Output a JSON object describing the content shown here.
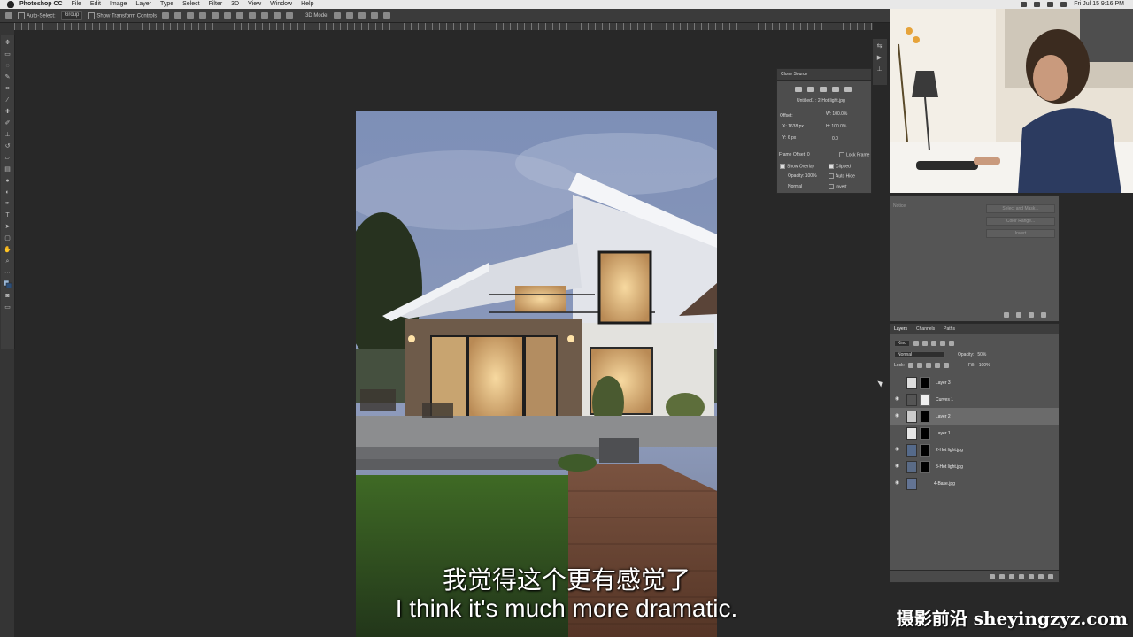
{
  "menubar": {
    "app_name": "Photoshop CC",
    "items": [
      "File",
      "Edit",
      "Image",
      "Layer",
      "Type",
      "Select",
      "Filter",
      "3D",
      "View",
      "Window",
      "Help"
    ],
    "clock": "Fri Jul 15  9:16 PM"
  },
  "optionsbar": {
    "auto_select_label": "Auto-Select:",
    "auto_select_value": "Group",
    "show_transform_label": "Show Transform Controls",
    "mode_3d_label": "3D Mode:"
  },
  "clone_source": {
    "title": "Clone Source",
    "source_name": "Untitled1 : 2-Hot light.jpg",
    "offset_label": "Offset:",
    "w_value": "W: 100.0%",
    "h_value": "H: 100.0%",
    "x_value": "X: 1638 px",
    "y_value": "Y: 6 px",
    "angle_value": "0.0",
    "frame_offset_label": "Frame Offset: 0",
    "lock_frame_label": "Lock Frame",
    "show_overlay_label": "Show Overlay",
    "clipped_label": "Clipped",
    "opacity_label": "Opacity: 100%",
    "auto_hide_label": "Auto Hide",
    "blend_value": "Normal",
    "invert_label": "Invert"
  },
  "properties": {
    "label": "Notice",
    "select_mask_label": "Select and Mask...",
    "color_range_label": "Color Range...",
    "invert_label": "Invert"
  },
  "layers": {
    "tabs": [
      "Layers",
      "Channels",
      "Paths"
    ],
    "kind_filter": "Kind",
    "blend_mode": "Normal",
    "opacity_label": "Opacity:",
    "opacity_value": "50%",
    "lock_label": "Lock:",
    "fill_label": "Fill:",
    "fill_value": "100%",
    "items": [
      {
        "name": "Layer 3",
        "visible": false,
        "mask": "black"
      },
      {
        "name": "Curves 1",
        "visible": true,
        "mask": "white"
      },
      {
        "name": "Layer 2",
        "visible": true,
        "mask": "black",
        "selected": true
      },
      {
        "name": "Layer 1",
        "visible": false,
        "mask": "black"
      },
      {
        "name": "2-Hot light.jpg",
        "visible": true,
        "mask": "black"
      },
      {
        "name": "3-Hot light.jpg",
        "visible": true,
        "mask": "black"
      },
      {
        "name": "4-Base.jpg",
        "visible": true,
        "mask": "none"
      }
    ]
  },
  "subtitles": {
    "zh": "我觉得这个更有感觉了",
    "en": "I think it's much more dramatic."
  },
  "watermark": "摄影前沿 sheyingzyz.com",
  "colors": {
    "canvas_bg": "#282828",
    "panel_bg": "#535353",
    "selected_layer": "#6b6b6b"
  }
}
